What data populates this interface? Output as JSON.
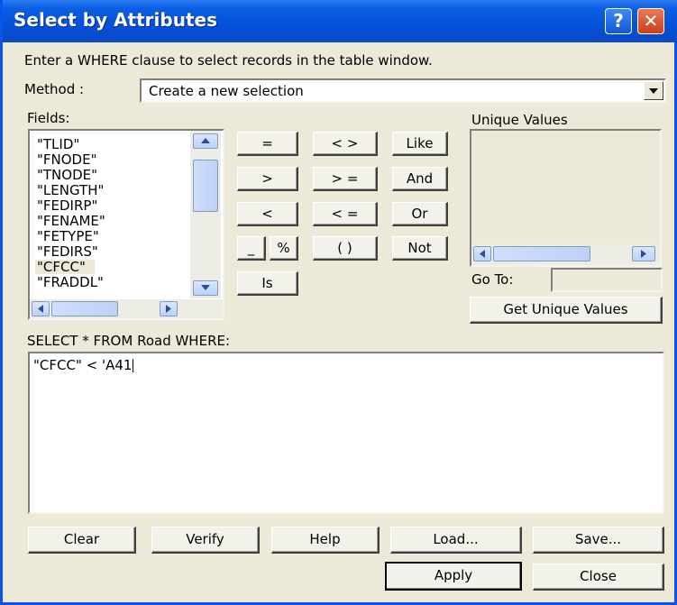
{
  "window": {
    "title": "Select by Attributes",
    "help_button": "?",
    "close_button": "✕"
  },
  "instruction": "Enter a WHERE clause to select records in the table window.",
  "method": {
    "label": "Method :",
    "value": "Create a new selection"
  },
  "fields": {
    "label": "Fields:",
    "items": [
      "\"TLID\"",
      "\"FNODE\"",
      "\"TNODE\"",
      "\"LENGTH\"",
      "\"FEDIRP\"",
      "\"FENAME\"",
      "\"FETYPE\"",
      "\"FEDIRS\"",
      "\"CFCC\"",
      "\"FRADDL\""
    ],
    "selected": "\"CFCC\""
  },
  "operators": {
    "eq": "=",
    "ne": "< >",
    "like": "Like",
    "gt": ">",
    "ge": "> =",
    "and": "And",
    "lt": "<",
    "le": "< =",
    "or": "Or",
    "underscore": "_",
    "percent": "%",
    "parens": "( )",
    "not": "Not",
    "is": "Is"
  },
  "unique_values": {
    "label": "Unique Values",
    "goto_label": "Go To:",
    "goto_value": "",
    "get_button": "Get Unique Values"
  },
  "query": {
    "label": "SELECT * FROM Road WHERE:",
    "expression": "\"CFCC\" < 'A41"
  },
  "buttons": {
    "clear": "Clear",
    "verify": "Verify",
    "help": "Help",
    "load": "Load...",
    "save": "Save...",
    "apply": "Apply",
    "close": "Close"
  },
  "colors": {
    "titlebar": "#0550d8",
    "dialog_bg": "#ece9d8",
    "selection": "#ece9d8"
  }
}
